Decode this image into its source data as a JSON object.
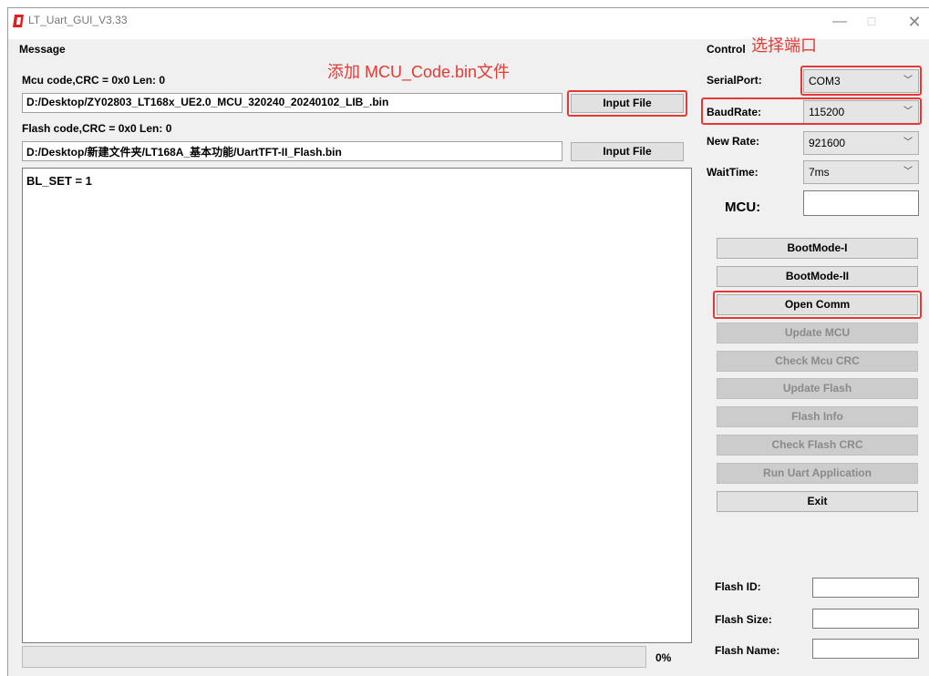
{
  "window": {
    "title": "LT_Uart_GUI_V3.33"
  },
  "annotations": {
    "mcu_file": "添加 MCU_Code.bin文件",
    "port": "选择端口"
  },
  "message": {
    "group_label": "Message",
    "mcu_info": "Mcu code,CRC = 0x0  Len: 0",
    "mcu_path": "D:/Desktop/ZY02803_LT168x_UE2.0_MCU_320240_20240102_LIB_.bin",
    "mcu_button": "Input File",
    "flash_info": "Flash code,CRC = 0x0  Len: 0",
    "flash_path": "D:/Desktop/新建文件夹/LT168A_基本功能/UartTFT-II_Flash.bin",
    "flash_button": "Input File",
    "log": "BL_SET = 1",
    "progress_percent": 0,
    "progress_label": "0%"
  },
  "control": {
    "group_label": "Control",
    "serial_port_label": "SerialPort:",
    "serial_port_value": "COM3",
    "baud_rate_label": "BaudRate:",
    "baud_rate_value": "115200",
    "new_rate_label": "New Rate:",
    "new_rate_value": "921600",
    "wait_time_label": "WaitTime:",
    "wait_time_value": "7ms",
    "mcu_label": "MCU:",
    "buttons": {
      "bootmode1": "BootMode-I",
      "bootmode2": "BootMode-II",
      "open_comm": "Open Comm",
      "update_mcu": "Update MCU",
      "check_mcu_crc": "Check Mcu CRC",
      "update_flash": "Update Flash",
      "flash_info": "Flash Info",
      "check_flash_crc": "Check Flash CRC",
      "run_uart": "Run Uart Application",
      "exit": "Exit"
    },
    "flash_id_label": "Flash ID:",
    "flash_size_label": "Flash Size:",
    "flash_name_label": "Flash Name:"
  },
  "colors": {
    "annotation": "#e53935",
    "icon": "#e02020"
  }
}
